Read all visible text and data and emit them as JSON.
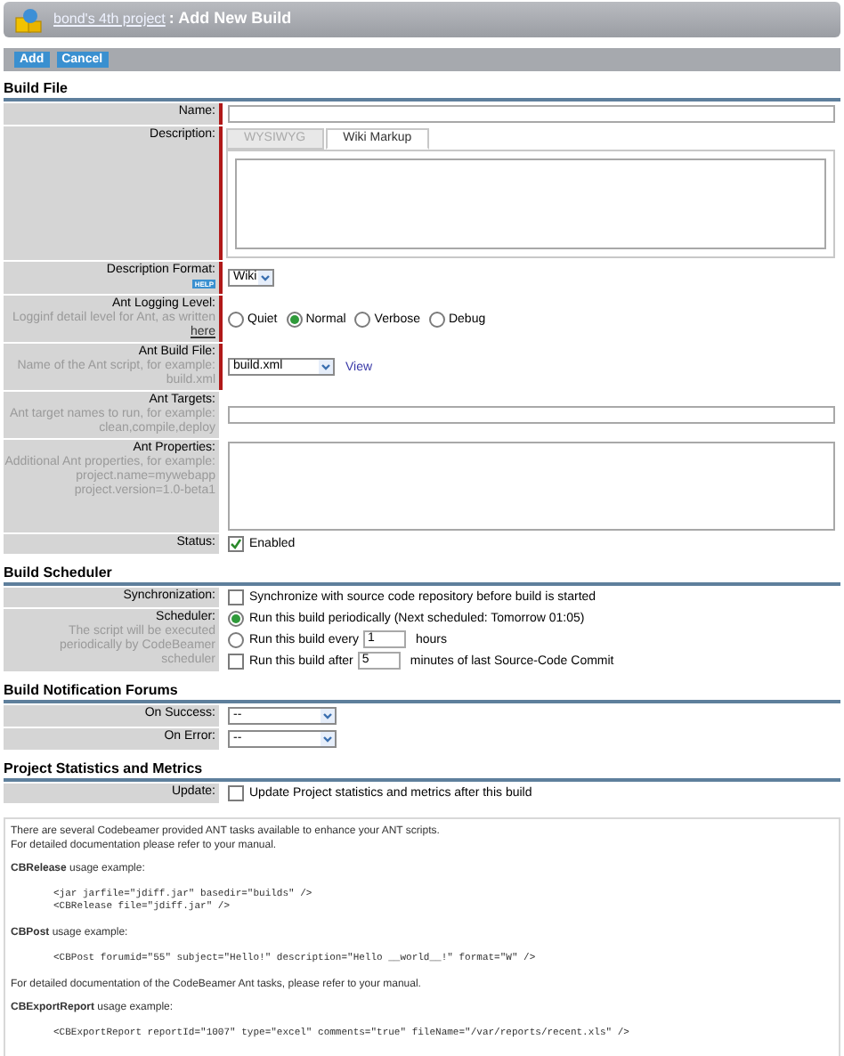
{
  "header": {
    "project_link": "bond's 4th project",
    "title": ": Add New Build"
  },
  "toolbar": {
    "buttons": [
      "Add",
      "Cancel"
    ]
  },
  "sections": [
    {
      "heading": "Build File",
      "rows": [
        {
          "kind": "text",
          "label": "Name:",
          "required": true
        },
        {
          "kind": "editor",
          "label": "Description:",
          "required": true,
          "tabs": [
            {
              "label": "WYSIWYG",
              "selected": false
            },
            {
              "label": "Wiki Markup",
              "selected": true
            }
          ]
        },
        {
          "kind": "select",
          "label": "Description Format:",
          "badge": "HELP",
          "value": "Wiki",
          "required": true
        },
        {
          "kind": "radios",
          "label": "Ant Logging Level:",
          "hint": "Logginf detail level for Ant, as written",
          "hint_link": "here",
          "required": true,
          "options": [
            {
              "label": "Quiet",
              "selected": false
            },
            {
              "label": "Normal",
              "selected": true
            },
            {
              "label": "Verbose",
              "selected": false
            },
            {
              "label": "Debug",
              "selected": false
            }
          ]
        },
        {
          "kind": "select",
          "label": "Ant Build File:",
          "hint": "Name of the Ant script, for example: build.xml",
          "value": "build.xml",
          "link": "View",
          "required": true
        },
        {
          "kind": "text",
          "label": "Ant Targets:",
          "hint": "Ant target names to run, for example: clean,compile,deploy",
          "required": false
        },
        {
          "kind": "textarea",
          "label": "Ant Properties:",
          "hint": "Additional Ant properties, for example: project.name=mywebapp project.version=1.0-beta1",
          "required": false
        },
        {
          "kind": "checkbox",
          "label": "Status:",
          "text": "Enabled",
          "checked": true,
          "required": false
        }
      ]
    },
    {
      "heading": "Build Scheduler",
      "rows": [
        {
          "kind": "checkbox",
          "label": "Synchronization:",
          "text": "Synchronize with source code repository before build is started",
          "checked": false,
          "required": false
        },
        {
          "kind": "scheduler",
          "label": "Scheduler:",
          "hint": "The script will be executed periodically by CodeBeamer scheduler",
          "required": false,
          "options": [
            {
              "kind": "radio",
              "text": "Run this build periodically (Next scheduled: Tomorrow 01:05)",
              "selected": true
            },
            {
              "kind": "radio",
              "text": "Run this build every",
              "value": "1",
              "after": "hours",
              "selected": false
            },
            {
              "kind": "checkbox",
              "text": "Run this build after",
              "value": "5",
              "after": "minutes of last Source-Code Commit",
              "checked": false
            }
          ]
        }
      ]
    },
    {
      "heading": "Build Notification Forums",
      "rows": [
        {
          "kind": "select",
          "label": "On Success:",
          "value": "--",
          "required": false
        },
        {
          "kind": "select",
          "label": "On Error:",
          "value": "--",
          "required": false
        }
      ]
    },
    {
      "heading": "Project Statistics and Metrics",
      "rows": [
        {
          "kind": "checkbox",
          "label": "Update:",
          "text": "Update Project statistics and metrics after this build",
          "checked": false,
          "required": false
        }
      ]
    }
  ],
  "info": [
    {
      "kind": "para",
      "text": "There are several Codebeamer provided ANT tasks available to enhance your ANT scripts."
    },
    {
      "kind": "para",
      "text": "For detailed documentation please refer to your manual."
    },
    {
      "kind": "heading",
      "text": "**CBRelease** usage example:"
    },
    {
      "kind": "code",
      "lines": [
        "<jar jarfile=\"jdiff.jar\" basedir=\"builds\" />",
        "<CBRelease file=\"jdiff.jar\" />"
      ]
    },
    {
      "kind": "heading",
      "text": "**CBPost** usage example:"
    },
    {
      "kind": "code",
      "lines": [
        "<CBPost forumid=\"55\" subject=\"Hello!\" description=\"Hello __world__!\" format=\"W\" />"
      ]
    },
    {
      "kind": "heading",
      "text": "For detailed documentation of the CodeBeamer Ant tasks, please refer to your manual."
    },
    {
      "kind": "heading",
      "text": "**CBExportReport** usage example:"
    },
    {
      "kind": "code",
      "lines": [
        "<CBExportReport reportId=\"1007\" type=\"excel\" comments=\"true\" fileName=\"/var/reports/recent.xls\" />"
      ]
    }
  ]
}
